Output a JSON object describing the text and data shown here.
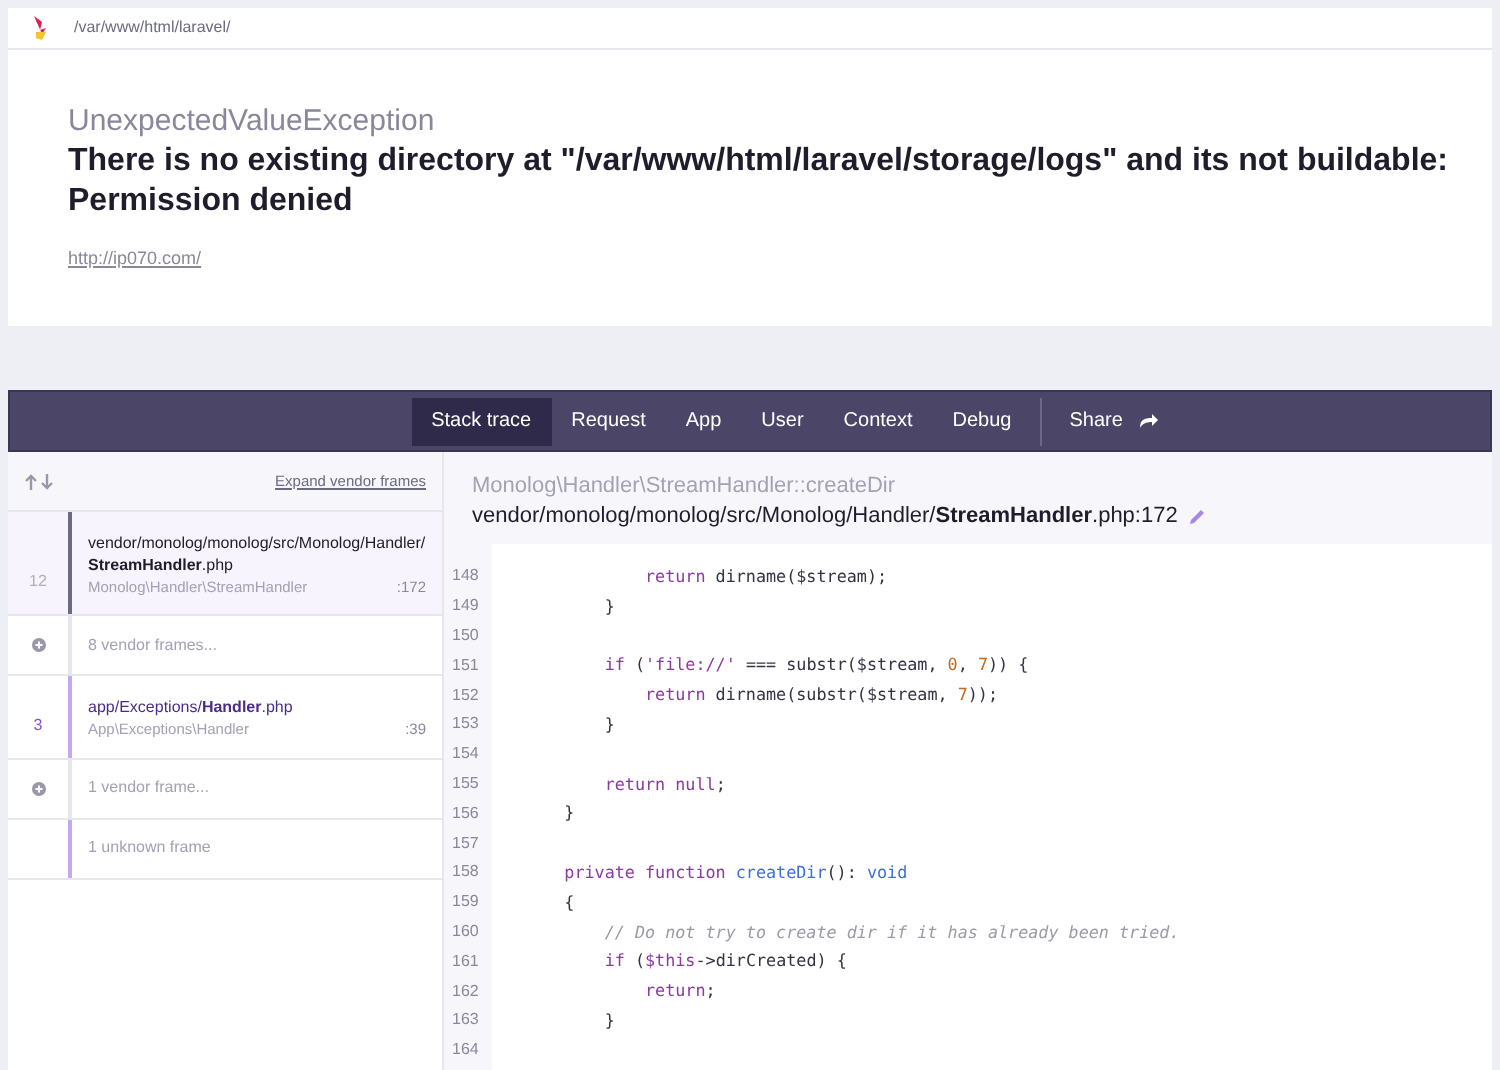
{
  "header": {
    "path": "/var/www/html/laravel/"
  },
  "exception": {
    "class": "UnexpectedValueException",
    "message": "There is no existing directory at \"/var/www/html/laravel/storage/logs\" and its not buildable: Permission denied",
    "url": "http://ip070.com/"
  },
  "tabs": [
    {
      "label": "Stack trace",
      "selected": true
    },
    {
      "label": "Request",
      "selected": false
    },
    {
      "label": "App",
      "selected": false
    },
    {
      "label": "User",
      "selected": false
    },
    {
      "label": "Context",
      "selected": false
    },
    {
      "label": "Debug",
      "selected": false
    }
  ],
  "share": {
    "label": "Share"
  },
  "frames_toolbar": {
    "expand_link": "Expand vendor frames"
  },
  "frames": [
    {
      "kind": "frame",
      "number": "12",
      "file": "vendor/monolog/monolog/src/Monolog/Handler/**StreamHandler**.php",
      "class": "Monolog\\Handler\\StreamHandler",
      "line": ":172",
      "selected": true,
      "app": false
    },
    {
      "kind": "group",
      "label": "8 vendor frames..."
    },
    {
      "kind": "frame",
      "number": "3",
      "file": "app/Exceptions/**Handler**.php",
      "class": "App\\Exceptions\\Handler",
      "line": ":39",
      "selected": false,
      "app": true
    },
    {
      "kind": "group",
      "label": "1 vendor frame..."
    },
    {
      "kind": "unknown",
      "label": "1 unknown frame"
    }
  ],
  "source": {
    "method": "Monolog\\Handler\\StreamHandler::createDir",
    "file": "vendor/monolog/monolog/src/Monolog/Handler/**StreamHandler**.php:172",
    "lines": [
      {
        "number": "148",
        "segments": [
          {
            "text": "            return",
            "kind": "keyword"
          },
          {
            "text": " dirname($stream);",
            "kind": "plain"
          }
        ]
      },
      {
        "number": "149",
        "segments": [
          {
            "text": "        }",
            "kind": "plain"
          }
        ]
      },
      {
        "number": "150"
      },
      {
        "number": "151",
        "segments": [
          {
            "text": "        if",
            "kind": "keyword"
          },
          {
            "text": " (",
            "kind": "plain"
          },
          {
            "text": "'file://'",
            "kind": "string"
          },
          {
            "text": " === substr($stream, ",
            "kind": "plain"
          },
          {
            "text": "0",
            "kind": "number"
          },
          {
            "text": ", ",
            "kind": "plain"
          },
          {
            "text": "7",
            "kind": "number"
          },
          {
            "text": ")) {",
            "kind": "plain"
          }
        ]
      },
      {
        "number": "152",
        "segments": [
          {
            "text": "            return",
            "kind": "keyword"
          },
          {
            "text": " dirname(substr($stream, ",
            "kind": "plain"
          },
          {
            "text": "7",
            "kind": "number"
          },
          {
            "text": "));",
            "kind": "plain"
          }
        ]
      },
      {
        "number": "153",
        "segments": [
          {
            "text": "        }",
            "kind": "plain"
          }
        ]
      },
      {
        "number": "154"
      },
      {
        "number": "155",
        "segments": [
          {
            "text": "        return",
            "kind": "keyword"
          },
          {
            "text": " null",
            "kind": "keyword"
          },
          {
            "text": ";",
            "kind": "plain"
          }
        ]
      },
      {
        "number": "156",
        "segments": [
          {
            "text": "    }",
            "kind": "plain"
          }
        ]
      },
      {
        "number": "157"
      },
      {
        "number": "158",
        "segments": [
          {
            "text": "    private function",
            "kind": "keyword"
          },
          {
            "text": " createDir",
            "kind": "function"
          },
          {
            "text": "(): ",
            "kind": "plain"
          },
          {
            "text": "void",
            "kind": "function"
          }
        ]
      },
      {
        "number": "159",
        "segments": [
          {
            "text": "    {",
            "kind": "plain"
          }
        ]
      },
      {
        "number": "160",
        "segments": [
          {
            "text": "        // Do not try to create dir if it has already been tried.",
            "kind": "comment"
          }
        ]
      },
      {
        "number": "161",
        "segments": [
          {
            "text": "        if",
            "kind": "keyword"
          },
          {
            "text": " (",
            "kind": "plain"
          },
          {
            "text": "$this",
            "kind": "keyword"
          },
          {
            "text": "->dirCreated) {",
            "kind": "plain"
          }
        ]
      },
      {
        "number": "162",
        "segments": [
          {
            "text": "            return",
            "kind": "keyword"
          },
          {
            "text": ";",
            "kind": "plain"
          }
        ]
      },
      {
        "number": "163",
        "segments": [
          {
            "text": "        }",
            "kind": "plain"
          }
        ]
      },
      {
        "number": "164"
      }
    ]
  }
}
